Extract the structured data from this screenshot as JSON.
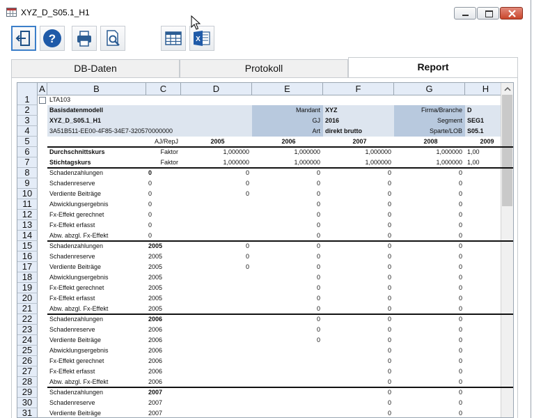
{
  "window": {
    "title": "XYZ_D_S05.1_H1"
  },
  "toolbar": {
    "buttons": [
      "exit-icon",
      "help-icon",
      "print-icon",
      "print-preview-icon",
      "table-icon",
      "excel-icon"
    ]
  },
  "tabs": [
    {
      "label": "DB-Daten"
    },
    {
      "label": "Protokoll"
    },
    {
      "label": "Report"
    }
  ],
  "sheet": {
    "columns": [
      "A",
      "B",
      "C",
      "D",
      "E",
      "F",
      "G",
      "H"
    ],
    "row_numbers": [
      "1",
      "2",
      "3",
      "4",
      "5",
      "6",
      "7",
      "8",
      "9",
      "10",
      "11",
      "12",
      "13",
      "14",
      "15",
      "16",
      "17",
      "18",
      "19",
      "20",
      "21",
      "22",
      "23",
      "24",
      "25",
      "26",
      "27",
      "28",
      "29",
      "30",
      "31"
    ],
    "r1": {
      "b": "LTA103"
    },
    "r2": {
      "b": "Basisdatenmodell",
      "e": "Mandant",
      "f": "XYZ",
      "g": "Firma/Branche",
      "h": "D"
    },
    "r3": {
      "b": "XYZ_D_S05.1_H1",
      "e": "GJ",
      "f": "2016",
      "g": "Segment",
      "h": "SEG1"
    },
    "r4": {
      "b": "3A51B511-EE00-4F85-34E7-320570000000",
      "e": "Art",
      "f": "direkt brutto",
      "g": "Sparte/LOB",
      "h": "S05.1"
    },
    "r5": {
      "c": "AJ/RepJ",
      "d": "2005",
      "e": "2006",
      "f": "2007",
      "g": "2008",
      "h": "2009"
    },
    "r6": {
      "b": "Durchschnittskurs",
      "c": "Faktor",
      "d": "1,000000",
      "e": "1,000000",
      "f": "1,000000",
      "g": "1,000000",
      "h": "1,00"
    },
    "r7": {
      "b": "Stichtagskurs",
      "c": "Faktor",
      "d": "1,000000",
      "e": "1,000000",
      "f": "1,000000",
      "g": "1,000000",
      "h": "1,00"
    },
    "rows": [
      {
        "b": "Schadenzahlungen",
        "c": "0",
        "d": "0",
        "e": "0",
        "f": "0",
        "g": "0"
      },
      {
        "b": "Schadenreserve",
        "c": "0",
        "d": "0",
        "e": "0",
        "f": "0",
        "g": "0"
      },
      {
        "b": "Verdiente Beiträge",
        "c": "0",
        "d": "0",
        "e": "0",
        "f": "0",
        "g": "0"
      },
      {
        "b": "Abwicklungsergebnis",
        "c": "0",
        "d": "",
        "e": "0",
        "f": "0",
        "g": "0"
      },
      {
        "b": "Fx-Effekt gerechnet",
        "c": "0",
        "d": "",
        "e": "0",
        "f": "0",
        "g": "0"
      },
      {
        "b": "Fx-Effekt erfasst",
        "c": "0",
        "d": "",
        "e": "0",
        "f": "0",
        "g": "0"
      },
      {
        "b": "Abw. abzgl. Fx-Effekt",
        "c": "0",
        "d": "",
        "e": "0",
        "f": "0",
        "g": "0"
      },
      {
        "b": "Schadenzahlungen",
        "c": "2005",
        "d": "0",
        "e": "0",
        "f": "0",
        "g": "0"
      },
      {
        "b": "Schadenreserve",
        "c": "2005",
        "d": "0",
        "e": "0",
        "f": "0",
        "g": "0"
      },
      {
        "b": "Verdiente Beiträge",
        "c": "2005",
        "d": "0",
        "e": "0",
        "f": "0",
        "g": "0"
      },
      {
        "b": "Abwicklungsergebnis",
        "c": "2005",
        "d": "",
        "e": "0",
        "f": "0",
        "g": "0"
      },
      {
        "b": "Fx-Effekt gerechnet",
        "c": "2005",
        "d": "",
        "e": "0",
        "f": "0",
        "g": "0"
      },
      {
        "b": "Fx-Effekt erfasst",
        "c": "2005",
        "d": "",
        "e": "0",
        "f": "0",
        "g": "0"
      },
      {
        "b": "Abw. abzgl. Fx-Effekt",
        "c": "2005",
        "d": "",
        "e": "0",
        "f": "0",
        "g": "0"
      },
      {
        "b": "Schadenzahlungen",
        "c": "2006",
        "d": "",
        "e": "0",
        "f": "0",
        "g": "0"
      },
      {
        "b": "Schadenreserve",
        "c": "2006",
        "d": "",
        "e": "0",
        "f": "0",
        "g": "0"
      },
      {
        "b": "Verdiente Beiträge",
        "c": "2006",
        "d": "",
        "e": "0",
        "f": "0",
        "g": "0"
      },
      {
        "b": "Abwicklungsergebnis",
        "c": "2006",
        "d": "",
        "e": "",
        "f": "0",
        "g": "0"
      },
      {
        "b": "Fx-Effekt gerechnet",
        "c": "2006",
        "d": "",
        "e": "",
        "f": "0",
        "g": "0"
      },
      {
        "b": "Fx-Effekt erfasst",
        "c": "2006",
        "d": "",
        "e": "",
        "f": "0",
        "g": "0"
      },
      {
        "b": "Abw. abzgl. Fx-Effekt",
        "c": "2006",
        "d": "",
        "e": "",
        "f": "0",
        "g": "0"
      },
      {
        "b": "Schadenzahlungen",
        "c": "2007",
        "d": "",
        "e": "",
        "f": "0",
        "g": "0"
      },
      {
        "b": "Schadenreserve",
        "c": "2007",
        "d": "",
        "e": "",
        "f": "0",
        "g": "0"
      },
      {
        "b": "Verdiente Beiträge",
        "c": "2007",
        "d": "",
        "e": "",
        "f": "0",
        "g": "0"
      }
    ]
  }
}
